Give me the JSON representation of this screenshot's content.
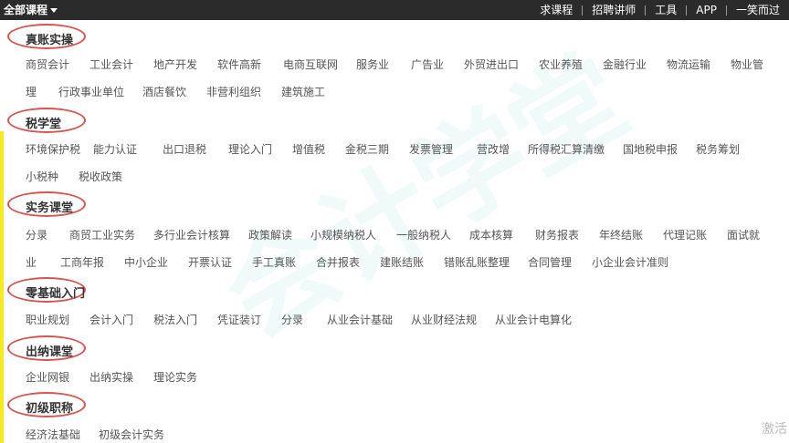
{
  "topbar": {
    "all_courses": "全部课程",
    "nav": [
      "求课程",
      "招聘讲师",
      "工具",
      "APP",
      "一笑而过"
    ]
  },
  "watermark": "会计学堂",
  "corner_text": "激活",
  "sections": [
    {
      "title": "真账实操",
      "rows": [
        [
          "商贸会计",
          "工业会计",
          "地产开发",
          "软件高新",
          "电商互联网",
          "服务业",
          "广告业",
          "外贸进出口",
          "农业养殖",
          "金融行业",
          "物流运输",
          "物业管"
        ],
        [
          "理",
          "行政事业单位",
          "酒店餐饮",
          "非营利组织",
          "建筑施工"
        ]
      ]
    },
    {
      "title": "税学堂",
      "rows": [
        [
          "环境保护税",
          "能力认证",
          "出口退税",
          "理论入门",
          "增值税",
          "金税三期",
          "发票管理",
          "营改增",
          "所得税汇算清缴",
          "国地税申报",
          "税务筹划"
        ],
        [
          "小税种",
          "税收政策"
        ]
      ]
    },
    {
      "title": "实务课堂",
      "rows": [
        [
          "分录",
          "商贸工业实务",
          "多行业会计核算",
          "政策解读",
          "小规模纳税人",
          "一般纳税人",
          "成本核算",
          "财务报表",
          "年终结账",
          "代理记账",
          "面试就"
        ],
        [
          "业",
          "工商年报",
          "中小企业",
          "开票认证",
          "手工真账",
          "合并报表",
          "建账结账",
          "错账乱账整理",
          "合同管理",
          "小企业会计准则"
        ]
      ]
    },
    {
      "title": "零基础入门",
      "rows": [
        [
          "职业规划",
          "会计入门",
          "税法入门",
          "凭证装订",
          "分录",
          "从业会计基础",
          "从业财经法规",
          "从业会计电算化"
        ]
      ]
    },
    {
      "title": "出纳课堂",
      "rows": [
        [
          "企业网银",
          "出纳实操",
          "理论实务"
        ]
      ]
    },
    {
      "title": "初级职称",
      "rows": [
        [
          "经济法基础",
          "初级会计实务"
        ]
      ]
    }
  ]
}
